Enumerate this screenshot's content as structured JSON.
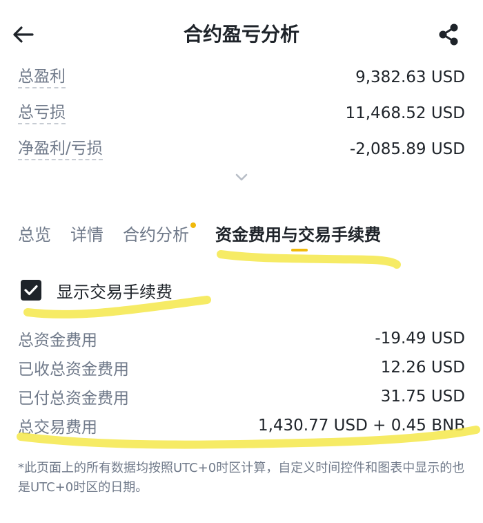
{
  "header": {
    "title": "合约盈亏分析",
    "back_icon": "arrow-left-icon",
    "share_icon": "share-icon"
  },
  "summary": [
    {
      "label": "总盈利",
      "value": "9,382.63 USD"
    },
    {
      "label": "总亏损",
      "value": "11,468.52 USD"
    },
    {
      "label": "净盈利/亏损",
      "value": "-2,085.89 USD"
    }
  ],
  "tabs": [
    {
      "label": "总览"
    },
    {
      "label": "详情"
    },
    {
      "label": "合约分析"
    },
    {
      "label": "资金费用与交易手续费"
    }
  ],
  "active_tab_index": 3,
  "checkbox": {
    "label": "显示交易手续费",
    "checked": true
  },
  "fees": [
    {
      "label": "总资金费用",
      "value": "-19.49 USD"
    },
    {
      "label": "已收总资金费用",
      "value": "12.26 USD"
    },
    {
      "label": "已付总资金费用",
      "value": "31.75 USD"
    },
    {
      "label": "总交易费用",
      "value": "1,430.77 USD + 0.45 BNB"
    }
  ],
  "footnote": "*此页面上的所有数据均按照UTC+0时区计算，自定义时间控件和图表中显示的也是UTC+0时区的日期。",
  "colors": {
    "accent": "#f0b90b",
    "text_primary": "#1e2329",
    "text_secondary": "#707a8a",
    "highlight_marker": "#f5e84a"
  }
}
